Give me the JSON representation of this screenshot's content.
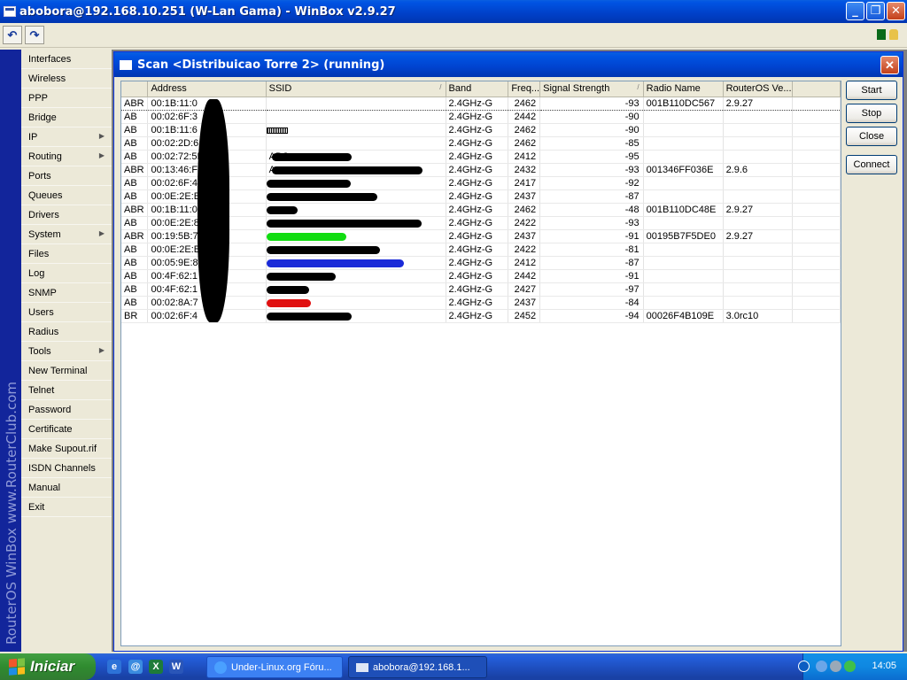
{
  "window": {
    "title": "abobora@192.168.10.251 (W-Lan Gama) - WinBox v2.9.27",
    "min": "_",
    "max": "❐",
    "close": "✕"
  },
  "toolbar": {
    "undo": "↶",
    "redo": "↷"
  },
  "brand": {
    "vertical_text": "RouterOS WinBox   www.RouterClub.com"
  },
  "menu": [
    {
      "label": "Interfaces",
      "submenu": false
    },
    {
      "label": "Wireless",
      "submenu": false
    },
    {
      "label": "PPP",
      "submenu": false
    },
    {
      "label": "Bridge",
      "submenu": false
    },
    {
      "label": "IP",
      "submenu": true
    },
    {
      "label": "Routing",
      "submenu": true
    },
    {
      "label": "Ports",
      "submenu": false
    },
    {
      "label": "Queues",
      "submenu": false
    },
    {
      "label": "Drivers",
      "submenu": false
    },
    {
      "label": "System",
      "submenu": true
    },
    {
      "label": "Files",
      "submenu": false
    },
    {
      "label": "Log",
      "submenu": false
    },
    {
      "label": "SNMP",
      "submenu": false
    },
    {
      "label": "Users",
      "submenu": false
    },
    {
      "label": "Radius",
      "submenu": false
    },
    {
      "label": "Tools",
      "submenu": true
    },
    {
      "label": "New Terminal",
      "submenu": false
    },
    {
      "label": "Telnet",
      "submenu": false
    },
    {
      "label": "Password",
      "submenu": false
    },
    {
      "label": "Certificate",
      "submenu": false
    },
    {
      "label": "Make Supout.rif",
      "submenu": false
    },
    {
      "label": "ISDN Channels",
      "submenu": false
    },
    {
      "label": "Manual",
      "submenu": false
    },
    {
      "label": "Exit",
      "submenu": false
    }
  ],
  "scan": {
    "title": "Scan <Distribuicao Torre 2> (running)",
    "close": "✕",
    "columns": [
      "",
      "Address",
      "SSID",
      "Band",
      "Freq...",
      "Signal Strength",
      "Radio Name",
      "RouterOS Ve..."
    ],
    "rows": [
      {
        "flags": "ABR",
        "address": "00:1B:11:0",
        "ssid": "",
        "band": "2.4GHz-G",
        "freq": "2462",
        "signal": "-93",
        "radio": "001B110DC567",
        "ros": "2.9.27",
        "scribble": ""
      },
      {
        "flags": "AB",
        "address": "00:02:6F:3",
        "ssid": "",
        "band": "2.4GHz-G",
        "freq": "2442",
        "signal": "-90",
        "radio": "",
        "ros": "",
        "scribble": ""
      },
      {
        "flags": "AB",
        "address": "00:1B:11:6",
        "ssid": "",
        "band": "2.4GHz-G",
        "freq": "2462",
        "signal": "-90",
        "radio": "",
        "ros": "",
        "scribble": "bars"
      },
      {
        "flags": "AB",
        "address": "00:02:2D:6",
        "ssid": "",
        "band": "2.4GHz-G",
        "freq": "2462",
        "signal": "-85",
        "radio": "",
        "ros": "",
        "scribble": ""
      },
      {
        "flags": "AB",
        "address": "00:02:72:5B",
        "ssid": "ABC",
        "band": "2.4GHz-G",
        "freq": "2412",
        "signal": "-95",
        "radio": "",
        "ros": "",
        "scribble": "#000000"
      },
      {
        "flags": "ABR",
        "address": "00:13:46:FF",
        "ssid": "A",
        "band": "2.4GHz-G",
        "freq": "2432",
        "signal": "-93",
        "radio": "001346FF036E",
        "ros": "2.9.6",
        "scribble": "#000000"
      },
      {
        "flags": "AB",
        "address": "00:02:6F:4",
        "ssid": "",
        "band": "2.4GHz-G",
        "freq": "2417",
        "signal": "-92",
        "radio": "",
        "ros": "",
        "scribble": "#000000"
      },
      {
        "flags": "AB",
        "address": "00:0E:2E:B",
        "ssid": "",
        "band": "2.4GHz-G",
        "freq": "2437",
        "signal": "-87",
        "radio": "",
        "ros": "",
        "scribble": "#000000"
      },
      {
        "flags": "ABR",
        "address": "00:1B:11:0",
        "ssid": "",
        "band": "2.4GHz-G",
        "freq": "2462",
        "signal": "-48",
        "radio": "001B110DC48E",
        "ros": "2.9.27",
        "scribble": "#000000"
      },
      {
        "flags": "AB",
        "address": "00:0E:2E:8",
        "ssid": "",
        "band": "2.4GHz-G",
        "freq": "2422",
        "signal": "-93",
        "radio": "",
        "ros": "",
        "scribble": "#000000"
      },
      {
        "flags": "ABR",
        "address": "00:19:5B:7",
        "ssid": "",
        "band": "2.4GHz-G",
        "freq": "2437",
        "signal": "-91",
        "radio": "00195B7F5DE0",
        "ros": "2.9.27",
        "scribble": "#11dd11"
      },
      {
        "flags": "AB",
        "address": "00:0E:2E:B",
        "ssid": "",
        "band": "2.4GHz-G",
        "freq": "2422",
        "signal": "-81",
        "radio": "",
        "ros": "",
        "scribble": "#000000"
      },
      {
        "flags": "AB",
        "address": "00:05:9E:8",
        "ssid": "",
        "band": "2.4GHz-G",
        "freq": "2412",
        "signal": "-87",
        "radio": "",
        "ros": "",
        "scribble": "#1a2ad8"
      },
      {
        "flags": "AB",
        "address": "00:4F:62:1",
        "ssid": "",
        "band": "2.4GHz-G",
        "freq": "2442",
        "signal": "-91",
        "radio": "",
        "ros": "",
        "scribble": "#000000"
      },
      {
        "flags": "AB",
        "address": "00:4F:62:1",
        "ssid": "",
        "band": "2.4GHz-G",
        "freq": "2427",
        "signal": "-97",
        "radio": "",
        "ros": "",
        "scribble": "#000000"
      },
      {
        "flags": "AB",
        "address": "00:02:8A:7",
        "ssid": "",
        "band": "2.4GHz-G",
        "freq": "2437",
        "signal": "-84",
        "radio": "",
        "ros": "",
        "scribble": "#e01010"
      },
      {
        "flags": "BR",
        "address": "00:02:6F:4",
        "ssid": "",
        "band": "2.4GHz-G",
        "freq": "2452",
        "signal": "-94",
        "radio": "00026F4B109E",
        "ros": "3.0rc10",
        "scribble": "#000000"
      }
    ],
    "buttons": {
      "start": "Start",
      "stop": "Stop",
      "close": "Close",
      "connect": "Connect"
    }
  },
  "taskbar": {
    "start": "Iniciar",
    "tasks": [
      {
        "label": "Under-Linux.org Fóru..."
      },
      {
        "label": "abobora@192.168.1..."
      }
    ],
    "clock": "14:05"
  }
}
